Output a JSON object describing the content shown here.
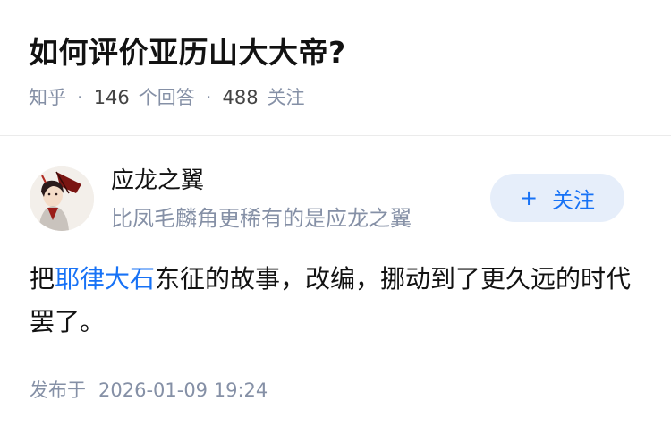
{
  "question": {
    "title": "如何评价亚历山大大帝?",
    "source": "知乎",
    "separator": "·",
    "answer_count": "146",
    "answer_label": "个回答",
    "follower_count": "488",
    "follower_label": "关注"
  },
  "author": {
    "name": "应龙之翼",
    "bio": "比凤毛麟角更稀有的是应龙之翼",
    "follow_plus": "+",
    "follow_label": "关注"
  },
  "answer": {
    "prefix": "把",
    "link_text": "耶律大石",
    "suffix": "东征的故事，改编，挪动到了更久远的时代罢了。"
  },
  "footer": {
    "published_label": "发布于",
    "published_date": "2026-01-09 19:24"
  },
  "colors": {
    "link": "#1772f6",
    "meta_gray": "#8590a6",
    "follow_bg": "#e6eefa"
  }
}
